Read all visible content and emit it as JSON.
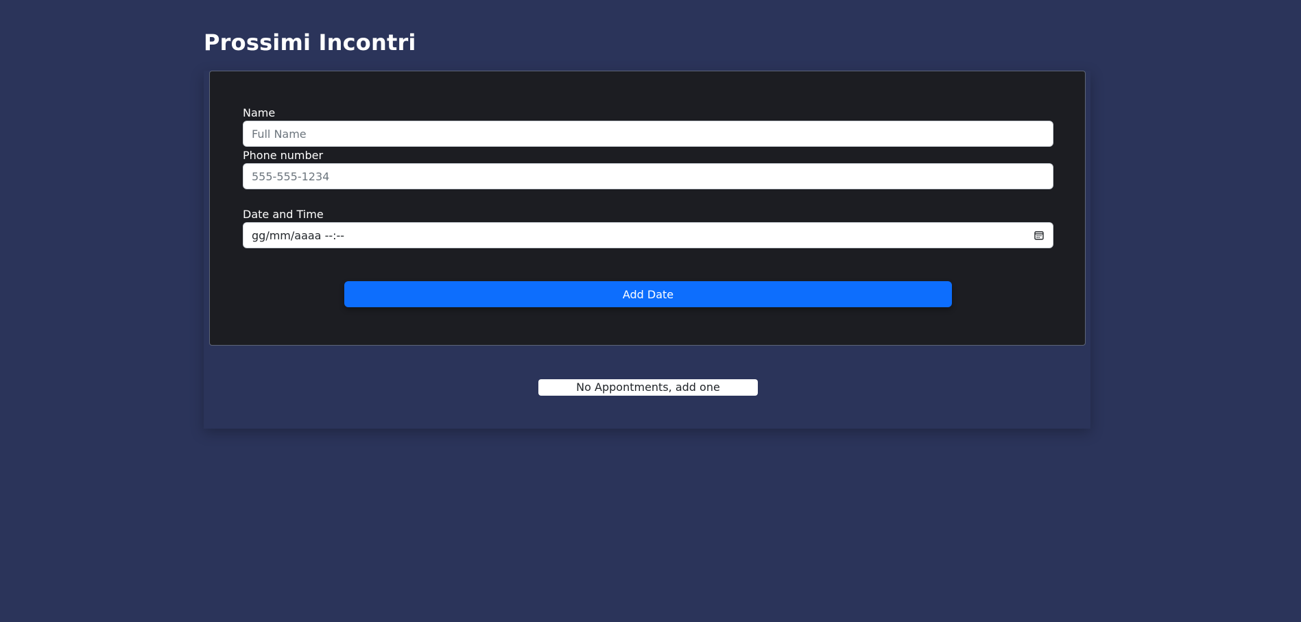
{
  "page": {
    "title": "Prossimi Incontri"
  },
  "form": {
    "name_label": "Name",
    "name_placeholder": "Full Name",
    "phone_label": "Phone number",
    "phone_placeholder": "555-555-1234",
    "datetime_label": "Date and Time",
    "datetime_placeholder": "gg/mm/aaaa --:--",
    "calendar_icon": "calendar-icon",
    "submit_label": "Add Date"
  },
  "appointments": {
    "empty_message": "No Appontments, add one"
  },
  "colors": {
    "background": "#2b345a",
    "card": "#1c1d22",
    "primary": "#0d6efd"
  }
}
